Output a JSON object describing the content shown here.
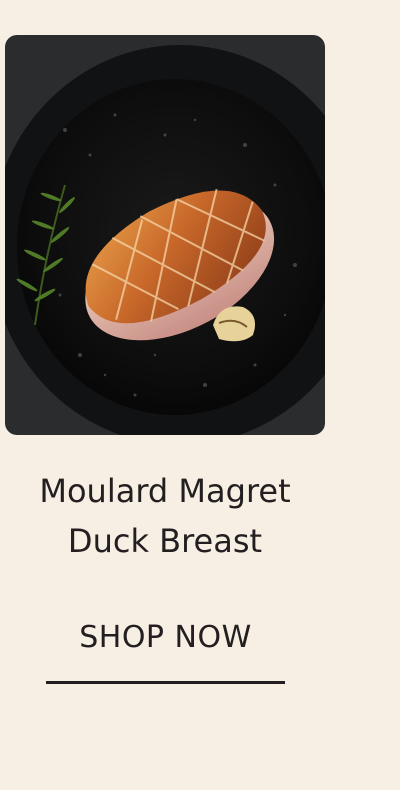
{
  "product": {
    "image_alt": "Seared duck breast in a cast iron pan with rosemary and garlic",
    "title_line1": "Moulard Magret",
    "title_line2": "Duck Breast"
  },
  "cta": {
    "label": "SHOP NOW"
  },
  "colors": {
    "background": "#f7efe4",
    "text": "#231f20"
  }
}
